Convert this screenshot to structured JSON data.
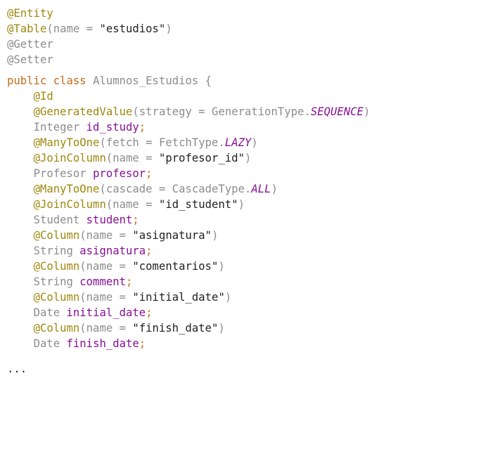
{
  "editor": {
    "lines": [
      {
        "indent": "",
        "tokens": [
          {
            "text": "@Entity",
            "kind": "annotation"
          }
        ]
      },
      {
        "indent": "",
        "tokens": [
          {
            "text": "@Table",
            "kind": "annotation"
          },
          {
            "text": "(name = ",
            "kind": "plain"
          },
          {
            "text": "\"estudios\"",
            "kind": "string-dark"
          },
          {
            "text": ")",
            "kind": "plain"
          }
        ]
      },
      {
        "indent": "",
        "tokens": [
          {
            "text": "@Getter",
            "kind": "annotation-dim"
          }
        ]
      },
      {
        "indent": "",
        "tokens": [
          {
            "text": "@Setter",
            "kind": "annotation-dim"
          }
        ]
      },
      {
        "indent": "",
        "tokens": [
          {
            "text": "public class ",
            "kind": "keyword2"
          },
          {
            "text": "Alumnos_Estudios ",
            "kind": "type"
          },
          {
            "text": "{",
            "kind": "plain"
          }
        ]
      },
      {
        "indent": "    ",
        "tokens": [
          {
            "text": "@Id",
            "kind": "annotation"
          }
        ]
      },
      {
        "indent": "    ",
        "tokens": [
          {
            "text": "@GeneratedValue",
            "kind": "annotation"
          },
          {
            "text": "(strategy = GenerationType.",
            "kind": "plain"
          },
          {
            "text": "SEQUENCE",
            "kind": "const"
          },
          {
            "text": ")",
            "kind": "plain"
          }
        ]
      },
      {
        "indent": "    ",
        "tokens": [
          {
            "text": "Integer ",
            "kind": "type"
          },
          {
            "text": "id_study",
            "kind": "field"
          },
          {
            "text": ";",
            "kind": "punct"
          }
        ]
      },
      {
        "indent": "    ",
        "tokens": [
          {
            "text": "@ManyToOne",
            "kind": "annotation"
          },
          {
            "text": "(fetch = FetchType.",
            "kind": "plain"
          },
          {
            "text": "LAZY",
            "kind": "const"
          },
          {
            "text": ")",
            "kind": "plain"
          }
        ]
      },
      {
        "indent": "    ",
        "tokens": [
          {
            "text": "@JoinColumn",
            "kind": "annotation"
          },
          {
            "text": "(name = ",
            "kind": "plain"
          },
          {
            "text": "\"profesor_id\"",
            "kind": "string-dark"
          },
          {
            "text": ")",
            "kind": "plain"
          }
        ]
      },
      {
        "indent": "    ",
        "tokens": [
          {
            "text": "Profesor ",
            "kind": "type"
          },
          {
            "text": "profesor",
            "kind": "field"
          },
          {
            "text": ";",
            "kind": "punct"
          }
        ]
      },
      {
        "indent": "    ",
        "tokens": [
          {
            "text": "@ManyToOne",
            "kind": "annotation"
          },
          {
            "text": "(cascade = CascadeType.",
            "kind": "plain"
          },
          {
            "text": "ALL",
            "kind": "const"
          },
          {
            "text": ")",
            "kind": "plain"
          }
        ]
      },
      {
        "indent": "    ",
        "tokens": [
          {
            "text": "@JoinColumn",
            "kind": "annotation"
          },
          {
            "text": "(name = ",
            "kind": "plain"
          },
          {
            "text": "\"id_student\"",
            "kind": "string-dark"
          },
          {
            "text": ")",
            "kind": "plain"
          }
        ]
      },
      {
        "indent": "    ",
        "tokens": [
          {
            "text": "Student ",
            "kind": "type"
          },
          {
            "text": "student",
            "kind": "field"
          },
          {
            "text": ";",
            "kind": "punct"
          }
        ]
      },
      {
        "indent": "    ",
        "tokens": [
          {
            "text": "@Column",
            "kind": "annotation"
          },
          {
            "text": "(name = ",
            "kind": "plain"
          },
          {
            "text": "\"asignatura\"",
            "kind": "string-dark"
          },
          {
            "text": ")",
            "kind": "plain"
          }
        ]
      },
      {
        "indent": "    ",
        "tokens": [
          {
            "text": "String ",
            "kind": "type"
          },
          {
            "text": "asignatura",
            "kind": "field"
          },
          {
            "text": ";",
            "kind": "punct"
          }
        ]
      },
      {
        "indent": "    ",
        "tokens": [
          {
            "text": "@Column",
            "kind": "annotation"
          },
          {
            "text": "(name = ",
            "kind": "plain"
          },
          {
            "text": "\"comentarios\"",
            "kind": "string-dark"
          },
          {
            "text": ")",
            "kind": "plain"
          }
        ]
      },
      {
        "indent": "    ",
        "tokens": [
          {
            "text": "String ",
            "kind": "type"
          },
          {
            "text": "comment",
            "kind": "field"
          },
          {
            "text": ";",
            "kind": "punct"
          }
        ]
      },
      {
        "indent": "    ",
        "tokens": [
          {
            "text": "@Column",
            "kind": "annotation"
          },
          {
            "text": "(name = ",
            "kind": "plain"
          },
          {
            "text": "\"initial_date\"",
            "kind": "string-dark"
          },
          {
            "text": ")",
            "kind": "plain"
          }
        ]
      },
      {
        "indent": "    ",
        "tokens": [
          {
            "text": "Date ",
            "kind": "type"
          },
          {
            "text": "initial_date",
            "kind": "field"
          },
          {
            "text": ";",
            "kind": "punct"
          }
        ]
      },
      {
        "indent": "    ",
        "tokens": [
          {
            "text": "@Column",
            "kind": "annotation"
          },
          {
            "text": "(name = ",
            "kind": "plain"
          },
          {
            "text": "\"finish_date\"",
            "kind": "string-dark"
          },
          {
            "text": ")",
            "kind": "plain"
          }
        ]
      },
      {
        "indent": "    ",
        "tokens": [
          {
            "text": "Date ",
            "kind": "type"
          },
          {
            "text": "finish_date",
            "kind": "field"
          },
          {
            "text": ";",
            "kind": "punct"
          }
        ]
      },
      {
        "indent": "",
        "tokens": [
          {
            "text": "...",
            "kind": "ellipsis"
          }
        ]
      }
    ]
  },
  "colors": {
    "annotation": "#9e880d",
    "keyword": "#c46b1a",
    "type": "#8c8c8c",
    "field": "#871094",
    "string": "#1f1f1f",
    "constant": "#871094",
    "background": "#ffffff"
  }
}
